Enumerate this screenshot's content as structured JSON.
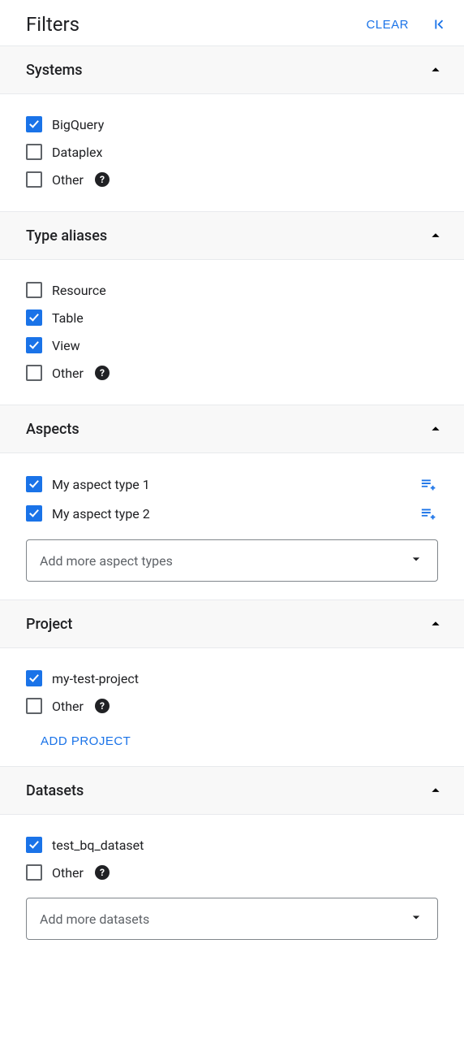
{
  "header": {
    "title": "Filters",
    "clear_label": "CLEAR"
  },
  "sections": {
    "systems": {
      "title": "Systems",
      "items": [
        {
          "label": "BigQuery",
          "checked": true,
          "help": false
        },
        {
          "label": "Dataplex",
          "checked": false,
          "help": false
        },
        {
          "label": "Other",
          "checked": false,
          "help": true
        }
      ]
    },
    "type_aliases": {
      "title": "Type aliases",
      "items": [
        {
          "label": "Resource",
          "checked": false,
          "help": false
        },
        {
          "label": "Table",
          "checked": true,
          "help": false
        },
        {
          "label": "View",
          "checked": true,
          "help": false
        },
        {
          "label": "Other",
          "checked": false,
          "help": true
        }
      ]
    },
    "aspects": {
      "title": "Aspects",
      "items": [
        {
          "label": "My aspect type 1",
          "checked": true,
          "rule": true
        },
        {
          "label": "My aspect type 2",
          "checked": true,
          "rule": true
        }
      ],
      "dropdown_placeholder": "Add more aspect types"
    },
    "project": {
      "title": "Project",
      "items": [
        {
          "label": "my-test-project",
          "checked": true,
          "help": false
        },
        {
          "label": "Other",
          "checked": false,
          "help": true
        }
      ],
      "add_button": "ADD PROJECT"
    },
    "datasets": {
      "title": "Datasets",
      "items": [
        {
          "label": "test_bq_dataset",
          "checked": true,
          "help": false
        },
        {
          "label": "Other",
          "checked": false,
          "help": true
        }
      ],
      "dropdown_placeholder": "Add more datasets"
    }
  }
}
